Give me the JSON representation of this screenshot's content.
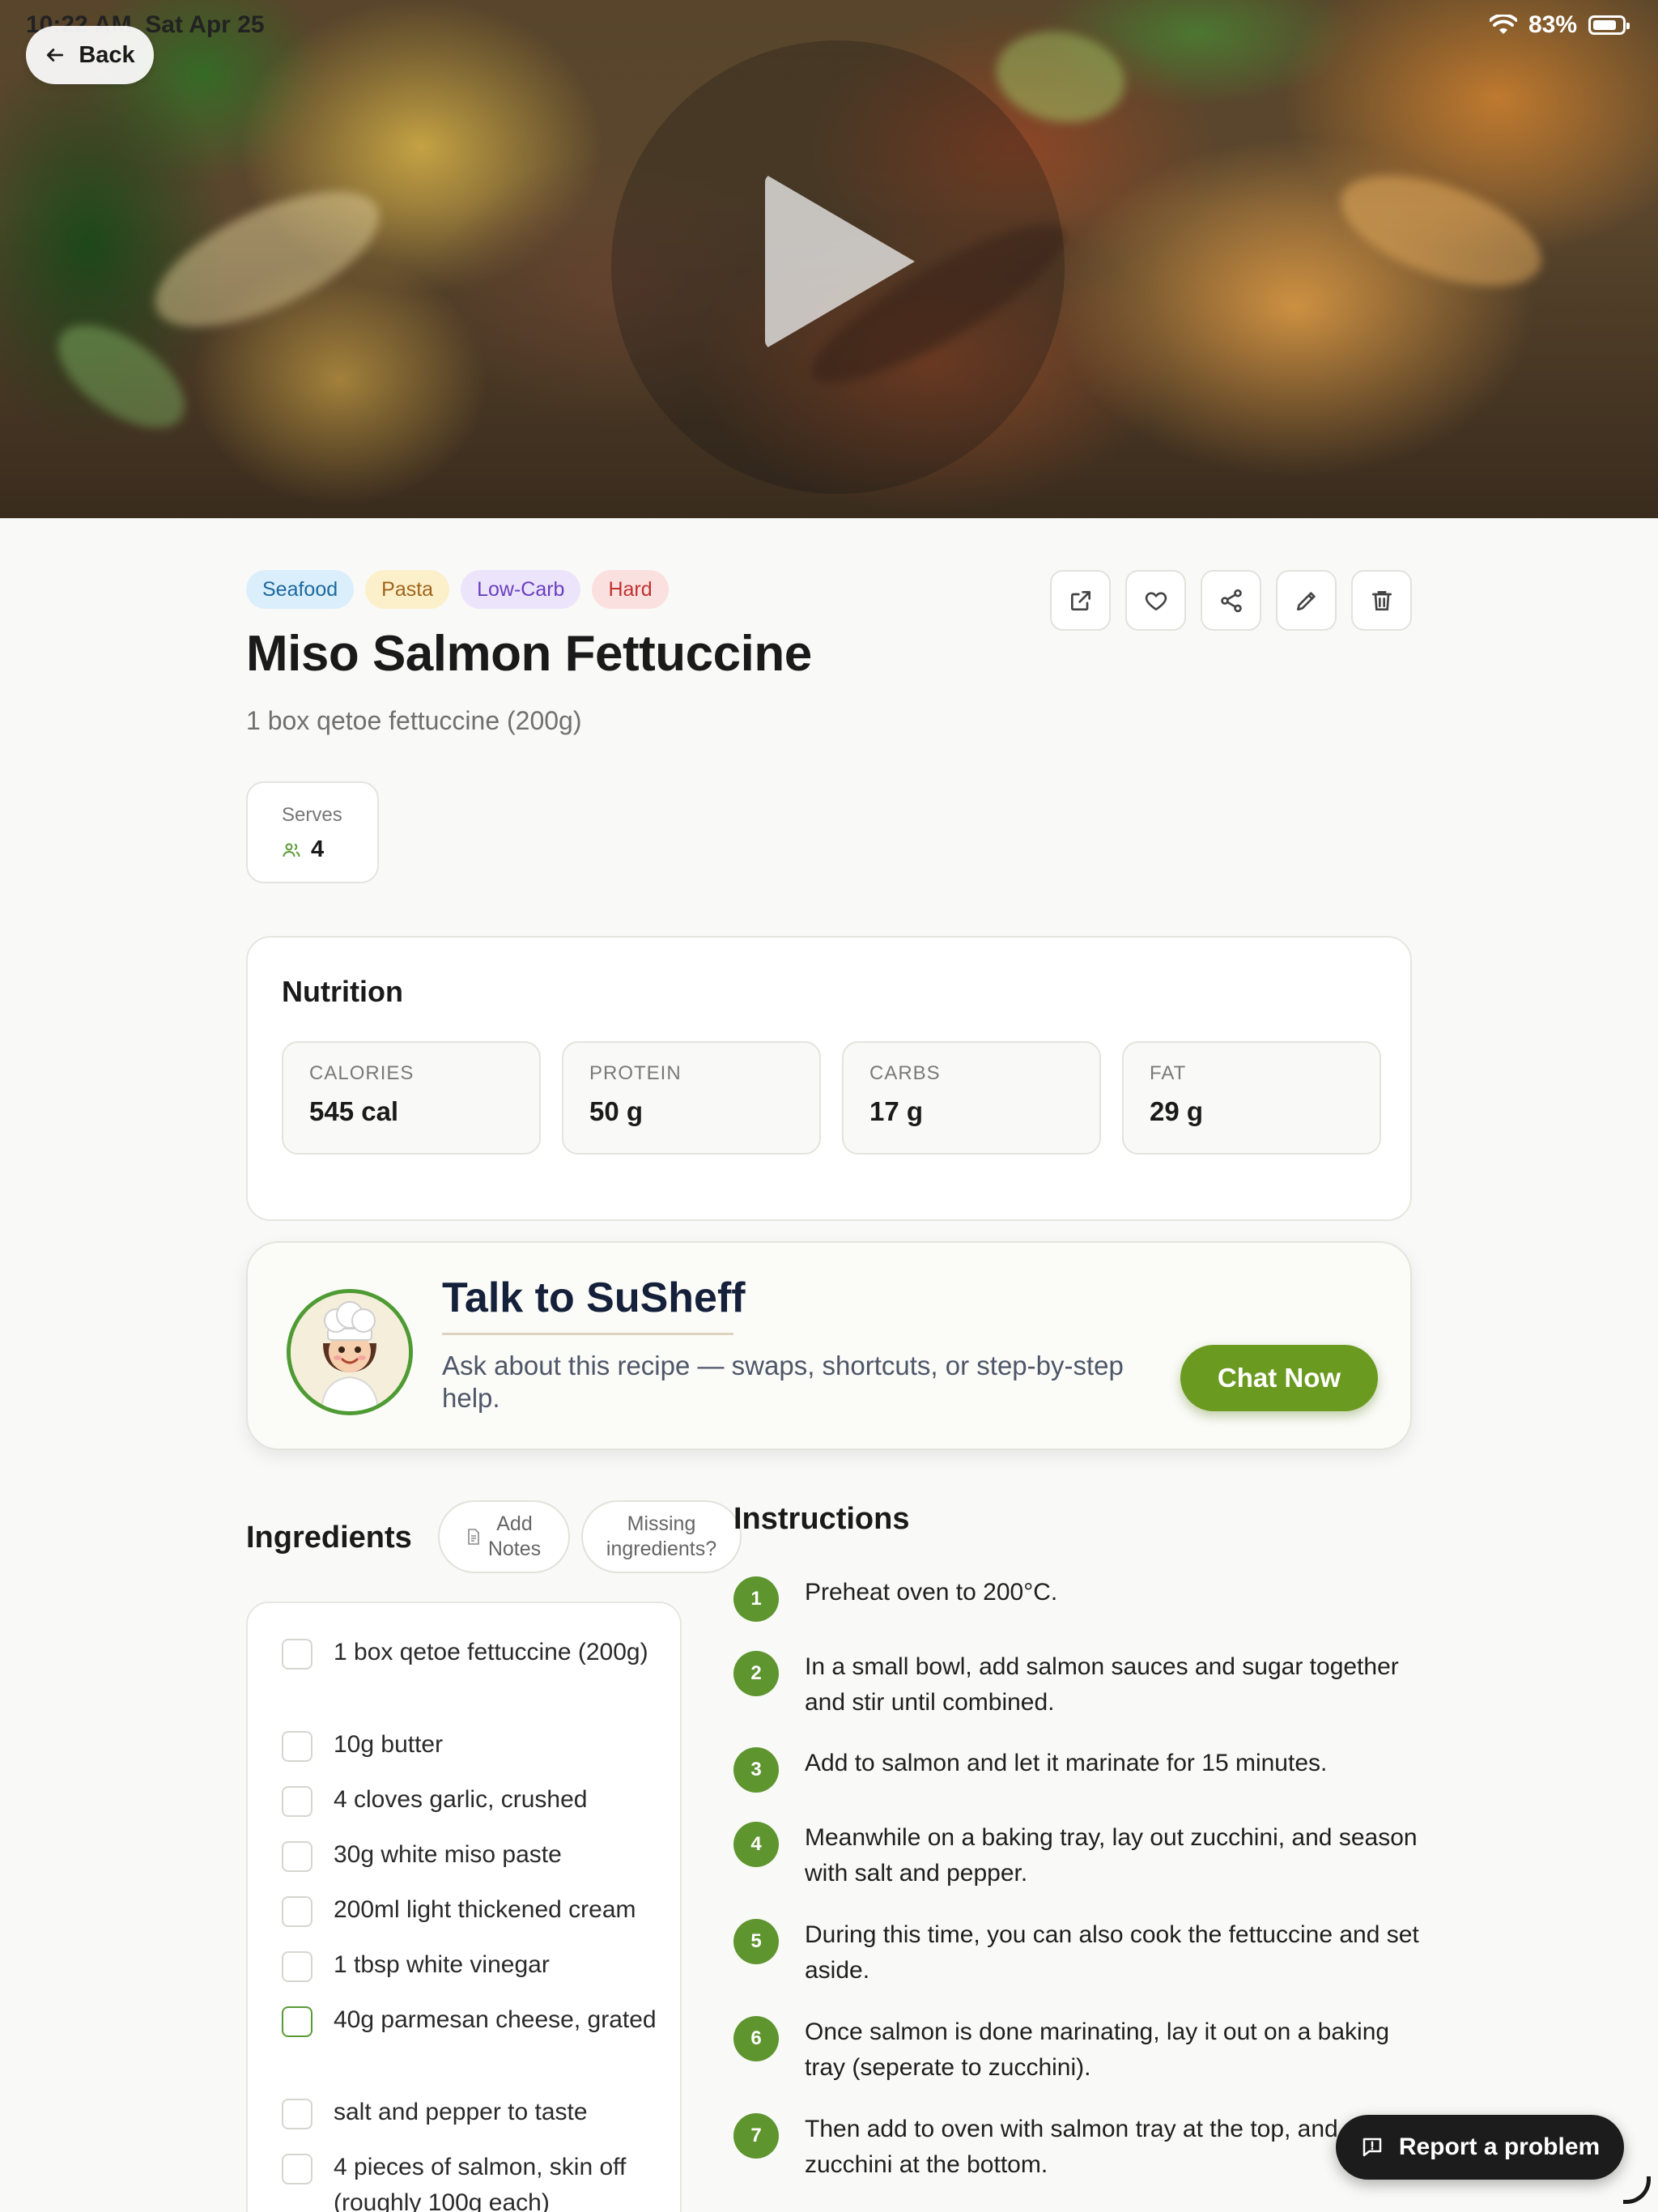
{
  "status_bar": {
    "time": "10:22 AM",
    "date": "Sat Apr 25",
    "battery": "83%",
    "battery_level": 0.83
  },
  "header": {
    "back_label": "Back"
  },
  "hero": {
    "media": "recipe-video",
    "play_icon": "play-icon"
  },
  "recipe": {
    "tags": [
      "Seafood",
      "Pasta",
      "Low-Carb",
      "Hard"
    ],
    "title": "Miso Salmon Fettuccine",
    "subtitle": "1 box qetoe fettuccine (200g)",
    "serves_label": "Serves",
    "serves_value": "4"
  },
  "actions": [
    "external-link-icon",
    "heart-icon",
    "share-icon",
    "edit-icon",
    "trash-icon"
  ],
  "nutrition": {
    "title": "Nutrition",
    "items": [
      {
        "label": "CALORIES",
        "value": "545 cal"
      },
      {
        "label": "PROTEIN",
        "value": "50 g"
      },
      {
        "label": "CARBS",
        "value": "17 g"
      },
      {
        "label": "FAT",
        "value": "29 g"
      }
    ]
  },
  "chat": {
    "title": "Talk to SuSheff",
    "description": "Ask about this recipe — swaps, shortcuts, or step-by-step help.",
    "button": "Chat Now"
  },
  "ingredients": {
    "title": "Ingredients",
    "add_notes_line1": "Add",
    "add_notes_line2": "Notes",
    "missing_line1": "Missing",
    "missing_line2": "ingredients?",
    "items": [
      "1 box qetoe fettuccine (200g)",
      "10g butter",
      "4 cloves garlic, crushed",
      "30g white miso paste",
      "200ml light thickened cream",
      "1 tbsp white vinegar",
      "40g parmesan cheese, grated",
      "salt and pepper to taste",
      "4 pieces of salmon, skin off (roughly 100g each)"
    ]
  },
  "instructions": {
    "title": "Instructions",
    "steps": [
      {
        "num": "1",
        "text": "Preheat oven to 200°C."
      },
      {
        "num": "2",
        "text": "In a small bowl, add salmon sauces and sugar together and stir until combined."
      },
      {
        "num": "3",
        "text": "Add to salmon and let it marinate for 15 minutes."
      },
      {
        "num": "4",
        "text": "Meanwhile on a baking tray, lay out zucchini, and season with salt and pepper."
      },
      {
        "num": "5",
        "text": "During this time, you can also cook the fettuccine and set aside."
      },
      {
        "num": "6",
        "text": "Once salmon is done marinating, lay it out on a baking tray (seperate to zucchini)."
      },
      {
        "num": "7",
        "text": "Then add to oven with salmon tray at the top, and zucchini at the bottom."
      }
    ]
  },
  "report": {
    "label": "Report a problem"
  }
}
